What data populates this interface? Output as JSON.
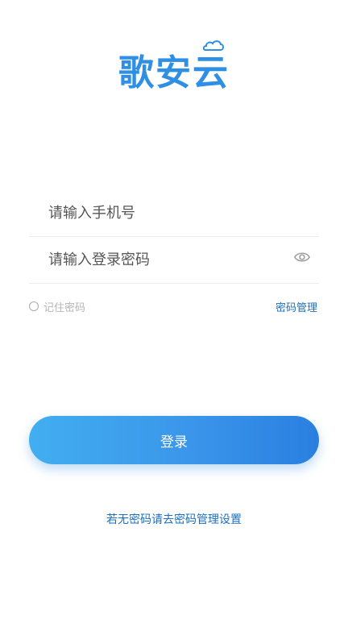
{
  "app": {
    "logo_text": "歌安云",
    "brand_color": "#2f8fe4"
  },
  "form": {
    "phone_placeholder": "请输入手机号",
    "password_placeholder": "请输入登录密码",
    "password_visibility_icon": "eye-icon"
  },
  "options": {
    "remember_label": "记住密码",
    "password_manage_label": "密码管理"
  },
  "actions": {
    "login_label": "登录"
  },
  "footer": {
    "hint_text": "若无密码请去密码管理设置"
  }
}
